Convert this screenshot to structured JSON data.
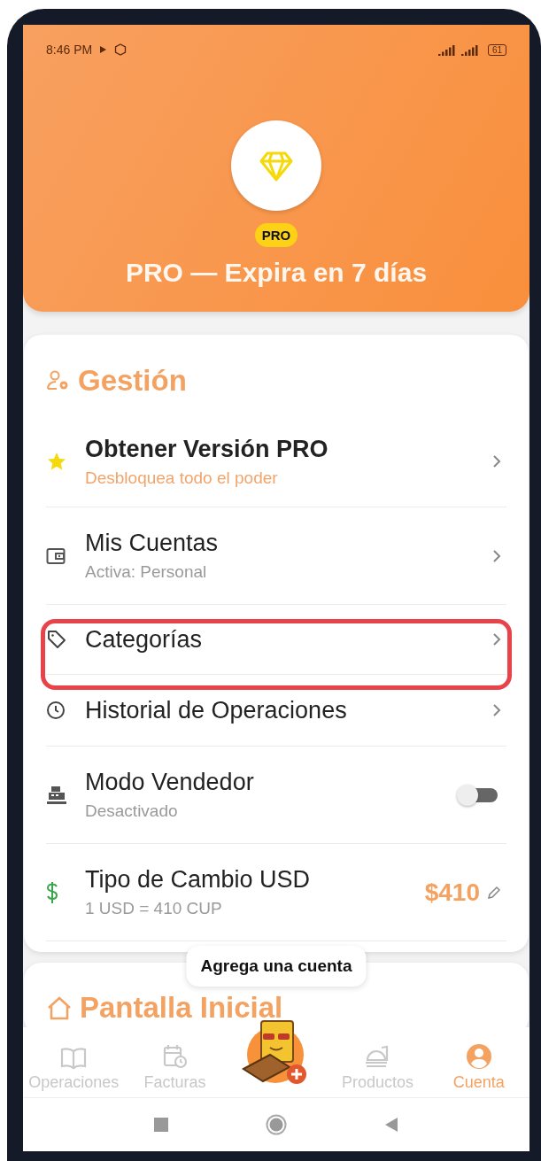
{
  "status_bar": {
    "time": "8:46 PM",
    "battery": "61"
  },
  "header": {
    "badge": "PRO",
    "title": "PRO — Expira en 7 días"
  },
  "section": {
    "title": "Gestión",
    "items": [
      {
        "kind": "promo",
        "title": "Obtener Versión PRO",
        "subtitle": "Desbloquea todo el poder"
      },
      {
        "kind": "link",
        "title": "Mis Cuentas",
        "subtitle": "Activa: Personal"
      },
      {
        "kind": "link",
        "title": "Categorías"
      },
      {
        "kind": "link",
        "title": "Historial de Operaciones"
      },
      {
        "kind": "toggle",
        "title": "Modo Vendedor",
        "subtitle": "Desactivado",
        "on": false
      },
      {
        "kind": "rate",
        "title": "Tipo de Cambio USD",
        "subtitle": "1 USD = 410 CUP",
        "value": "$410"
      }
    ]
  },
  "next_section": {
    "title": "Pantalla Inicial"
  },
  "tooltip": "Agrega una cuenta",
  "bottom_nav": [
    {
      "label": "Operaciones",
      "selected": false
    },
    {
      "label": "Facturas",
      "selected": false
    },
    {
      "label": "Productos",
      "selected": false
    },
    {
      "label": "Cuenta",
      "selected": true
    }
  ]
}
